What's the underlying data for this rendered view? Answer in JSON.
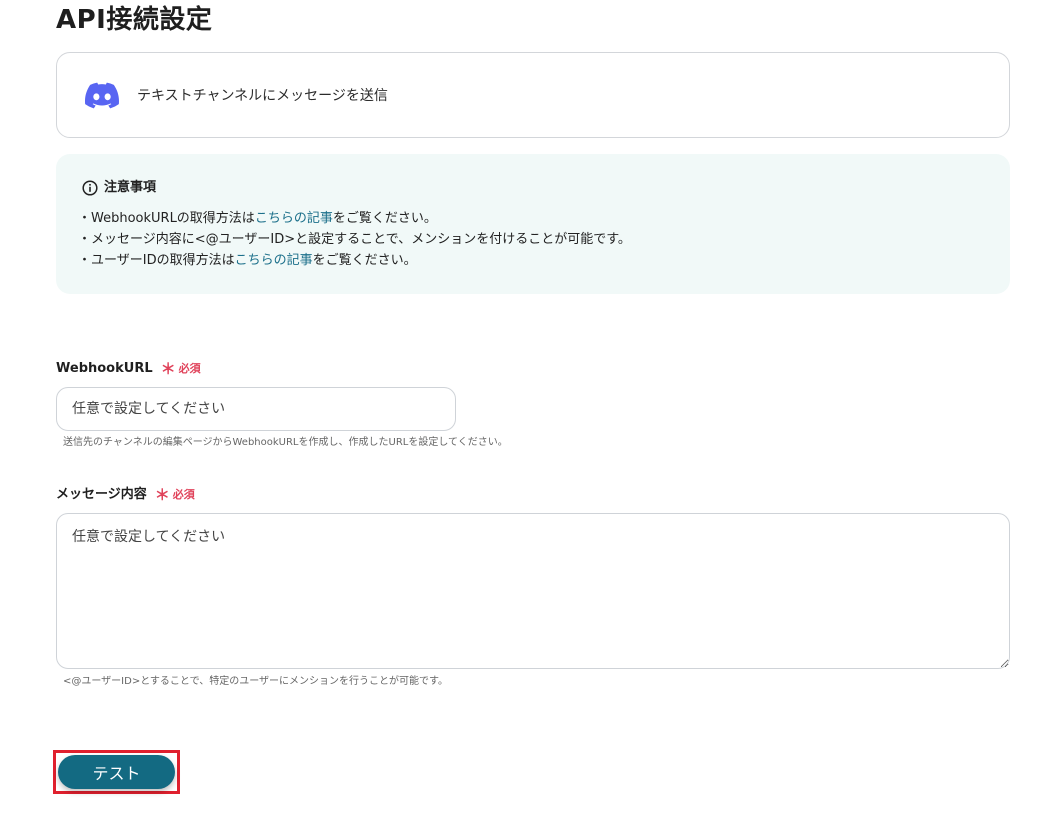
{
  "page": {
    "title": "API接続設定"
  },
  "action": {
    "label": "テキストチャンネルにメッセージを送信",
    "icon": "discord-icon",
    "icon_color": "#5865f2"
  },
  "notice": {
    "title": "注意事項",
    "icon": "info-icon",
    "lines": [
      {
        "before": "・WebhookURLの取得方法は",
        "link": "こちらの記事",
        "after": "をご覧ください。"
      },
      {
        "text": "・メッセージ内容に<@ユーザーID>と設定することで、メンションを付けることが可能です。"
      },
      {
        "before": "・ユーザーIDの取得方法は",
        "link": "こちらの記事",
        "after": "をご覧ください。"
      }
    ],
    "background_color": "#f1f9f8",
    "link_color": "#1b6f8a"
  },
  "webhook": {
    "label": "WebhookURL",
    "required_mark": "＊",
    "required_text": "必須",
    "placeholder": "任意で設定してください",
    "value": "",
    "help": "送信先のチャンネルの編集ページからWebhookURLを作成し、作成したURLを設定してください。"
  },
  "message": {
    "label": "メッセージ内容",
    "required_mark": "＊",
    "required_text": "必須",
    "placeholder": "任意で設定してください",
    "value": "",
    "help": "<@ユーザーID>とすることで、特定のユーザーにメンションを行うことが可能です。"
  },
  "test_button": {
    "label": "テスト",
    "color": "#136a82",
    "highlight_color": "#e0202e"
  }
}
